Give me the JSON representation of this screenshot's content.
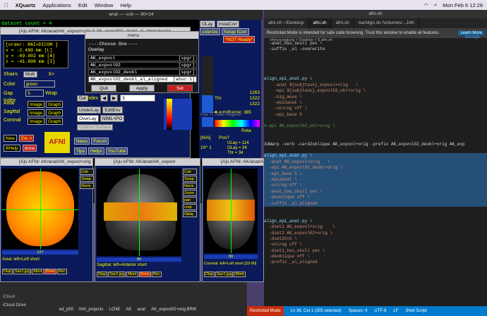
{
  "menubar": {
    "app": "XQuartz",
    "items": [
      "Applications",
      "Edit",
      "Window",
      "Help"
    ],
    "datetime": "Mon Feb 6  12:28"
  },
  "terminal": {
    "title": "anat — -csh — 80×24",
    "line1": "dataset count = 4"
  },
  "afni": {
    "title": "[A]u AFNI: AK/anat/AK_expvol+orig & AK_expvol02_deobl_al_aligned+orig",
    "info": {
      "order": "[order: RAI=DICOM ]",
      "x": "x = -2.490 mm [L]",
      "y": "y = -69.902 mm [A]",
      "z": "z = -41.808 mm [I]"
    },
    "xhairs_label": "Xhairs",
    "xhairs_value": "Multi",
    "xplus": "X+",
    "color_label": "Color",
    "color_value": "green",
    "gap_label": "Gap",
    "gap_value": "5",
    "wrap": "Wrap",
    "index_label": "Index",
    "views": [
      {
        "name": "Axial",
        "img": "Image",
        "graph": "Graph"
      },
      {
        "name": "Sagittal",
        "img": "Image",
        "graph": "Graph"
      },
      {
        "name": "Coronal",
        "img": "Image",
        "graph": "Graph"
      }
    ],
    "new": "New",
    "etc": "Etc->",
    "bhelp": "BHelp",
    "done": "done",
    "logo": "AFNI",
    "news": "News",
    "forum": "Forum",
    "tips": "Tips",
    "helps": "Helps",
    "youtube": "YouTube",
    "dat": "Dat",
    "underlay": "UnderLay",
    "overlay": "OverLay",
    "editenv": "EditEnv",
    "niml": "NIML+PO",
    "control_surface": "Control Surface"
  },
  "menu": {
    "title": "menu",
    "header": "----Choose One----",
    "subheader": "Overlay",
    "items": [
      {
        "name": "AK_expvol",
        "tag": "[spgr]"
      },
      {
        "name": "AK_expvol02",
        "tag": "[spgr]"
      },
      {
        "name": "AK_expvol02_deobl",
        "tag": "[spgr]"
      },
      {
        "name": "AK_expvol02_deobl_al_aligned",
        "tag": "[abuc:1]"
      }
    ],
    "quit": "Quit",
    "apply": "Apply",
    "set": "Set",
    "index_label": "Index",
    "index_value": "3"
  },
  "right_panel": {
    "olay": "OLay",
    "insta": "InstaCorr",
    "cluster": "usterize",
    "setup": "Setup ICorr",
    "notready": "*NOT Ready*",
    "thr": "Thr",
    "values": [
      "1263",
      "1322",
      "1322"
    ],
    "autorange_label": "autoRange:",
    "autorange_value": "385",
    "rota": "Rota",
    "num1": "1",
    "nv": "[N/A]",
    "pos": "Pos?",
    "ten": "10^",
    "ten_val": "1",
    "ulay": "ULay = 114",
    "olay_val": "OLay = 34",
    "thr_val": "Thr  = 34",
    "use_tt": "Use TT Atlas Regions"
  },
  "vscode": {
    "title": "afni.sh",
    "tabs": [
      "afni.sh ~/Desktop",
      "afni.sh",
      "afni.sh",
      "tseAlign.sh /Volumes/...JAK"
    ],
    "banner": "Restricted Mode is intended for safe code browsing. Trust this window to enable all features.",
    "banner_manage": "Manage",
    "banner_learn": "Learn More",
    "breadcrumb": "shinyoungjung > Desktop > $ afni.sh",
    "lines": [
      {
        "t": "  -anat_has_skull yes \\",
        "c": "c-pl",
        "hl": false
      },
      {
        "t": "  -suffix _al -overwrite",
        "c": "c-pl",
        "hl": false
      },
      {
        "t": "",
        "c": "c-pl",
        "hl": false
      },
      {
        "t": "",
        "c": "c-pl",
        "hl": false
      },
      {
        "t": "",
        "c": "c-pl",
        "hl": false
      },
      {
        "t": "",
        "c": "c-pl",
        "hl": false
      },
      {
        "t": "align_epi_anat.py \\",
        "c": "c-cmd",
        "hl": false
      },
      {
        "t": "    -anat ${subjtask}_expvol+orig   \\",
        "c": "c-str",
        "hl": false
      },
      {
        "t": "    -epi ${subjtask}_expvol02_obl+orig \\",
        "c": "c-str",
        "hl": false
      },
      {
        "t": "    -big_move \\",
        "c": "c-str",
        "hl": false
      },
      {
        "t": "    -epi2anat \\",
        "c": "c-str",
        "hl": false
      },
      {
        "t": "    -volreg off \\",
        "c": "c-str",
        "hl": false
      },
      {
        "t": "    -epi_base 5",
        "c": "c-str",
        "hl": false
      },
      {
        "t": "",
        "c": "c-pl",
        "hl": false
      },
      {
        "t": "#-epi AK_expvol02_obl+orig \\",
        "c": "c-com",
        "hl": false
      },
      {
        "t": "",
        "c": "c-pl",
        "hl": false
      },
      {
        "t": "",
        "c": "c-pl",
        "hl": false
      },
      {
        "t": "3dWarp -verb -card2oblique AK_expvol+orig -prefix AK_expvol02_deobl+orig AK_exp",
        "c": "c-pl",
        "hl": false
      },
      {
        "t": "",
        "c": "c-pl",
        "hl": false
      },
      {
        "t": "align_epi_anat.py \\",
        "c": "c-cmd",
        "hl": true
      },
      {
        "t": "  -anat AK_expvol+orig   \\",
        "c": "c-str",
        "hl": true
      },
      {
        "t": "  -epi AK_expvol02_deobl+orig \\",
        "c": "c-str",
        "hl": true
      },
      {
        "t": "  -epi_base 5 \\",
        "c": "c-str",
        "hl": true
      },
      {
        "t": "  -epi2anat \\",
        "c": "c-str",
        "hl": true
      },
      {
        "t": "  -volreg off \\",
        "c": "c-str",
        "hl": true
      },
      {
        "t": "  -anat_has_skull yes \\",
        "c": "c-str",
        "hl": true
      },
      {
        "t": "  -deoblique off \\",
        "c": "c-str",
        "hl": true
      },
      {
        "t": "  -suffix _al_aligned",
        "c": "c-str",
        "hl": true
      },
      {
        "t": "",
        "c": "c-pl",
        "hl": false
      },
      {
        "t": "",
        "c": "c-pl",
        "hl": false
      },
      {
        "t": "align_epi_anat.py \\",
        "c": "c-cmd",
        "hl": false
      },
      {
        "t": "  -dset1 AK_expvol+orig    \\",
        "c": "c-str",
        "hl": false
      },
      {
        "t": "  -dset2 AK_expvol02+orig \\",
        "c": "c-str",
        "hl": false
      },
      {
        "t": "  -dset2to1 \\",
        "c": "c-str",
        "hl": false
      },
      {
        "t": "  -volreg off \\",
        "c": "c-str",
        "hl": false
      },
      {
        "t": "  -dset1_has_skull yes \\",
        "c": "c-str",
        "hl": false
      },
      {
        "t": "  -deoblique off \\",
        "c": "c-str",
        "hl": false
      },
      {
        "t": "  -prefix _al_aligned",
        "c": "c-str",
        "hl": false
      }
    ],
    "status": {
      "restricted": "Restricted Mode",
      "pos": "Ln 36, Col 1 (205 selected)",
      "spaces": "Spaces: 4",
      "enc": "UTF-8",
      "eol": "LF",
      "lang": "Shell Script"
    }
  },
  "image_windows": [
    {
      "title": "[A]u AFNI: AK/anat/AK_expvol+orig",
      "caption": "Axial: left=Left  short",
      "slider": "127",
      "buttons": [
        "Disp",
        "Sav1.jpg",
        "Mont",
        "Done",
        "Rec"
      ]
    },
    {
      "title": "[A]u AFNI: AK/anat/AK_expvol",
      "caption": "Sagittal: left=Anterior  short",
      "slider": "80",
      "buttons": [
        "Disp",
        "Sav1.jpg",
        "Mont",
        "Done",
        "Rec"
      ]
    },
    {
      "title": "[A]u AFNI: AK/anat/AK_exp",
      "caption": "Coronal: left=Left  short [23-90]",
      "slider": "80",
      "buttons": [
        "Disp",
        "Sav1.jpg",
        "Mont",
        "Done",
        "Rec"
      ]
    }
  ],
  "side_buttons": [
    "Colr",
    "Swap",
    "Norm",
    "c",
    "b",
    "r",
    "g",
    "i",
    "v",
    "9",
    "Zoom",
    "pan",
    "crop",
    "Obliq"
  ],
  "finder": {
    "path": [
      "ed_p50",
      "fmri_projects",
      "LCNE",
      "AK",
      "anat",
      "AK_expvol02+orig.BRIK"
    ],
    "icloud": "iCloud",
    "drive": "iCloud Drive"
  }
}
